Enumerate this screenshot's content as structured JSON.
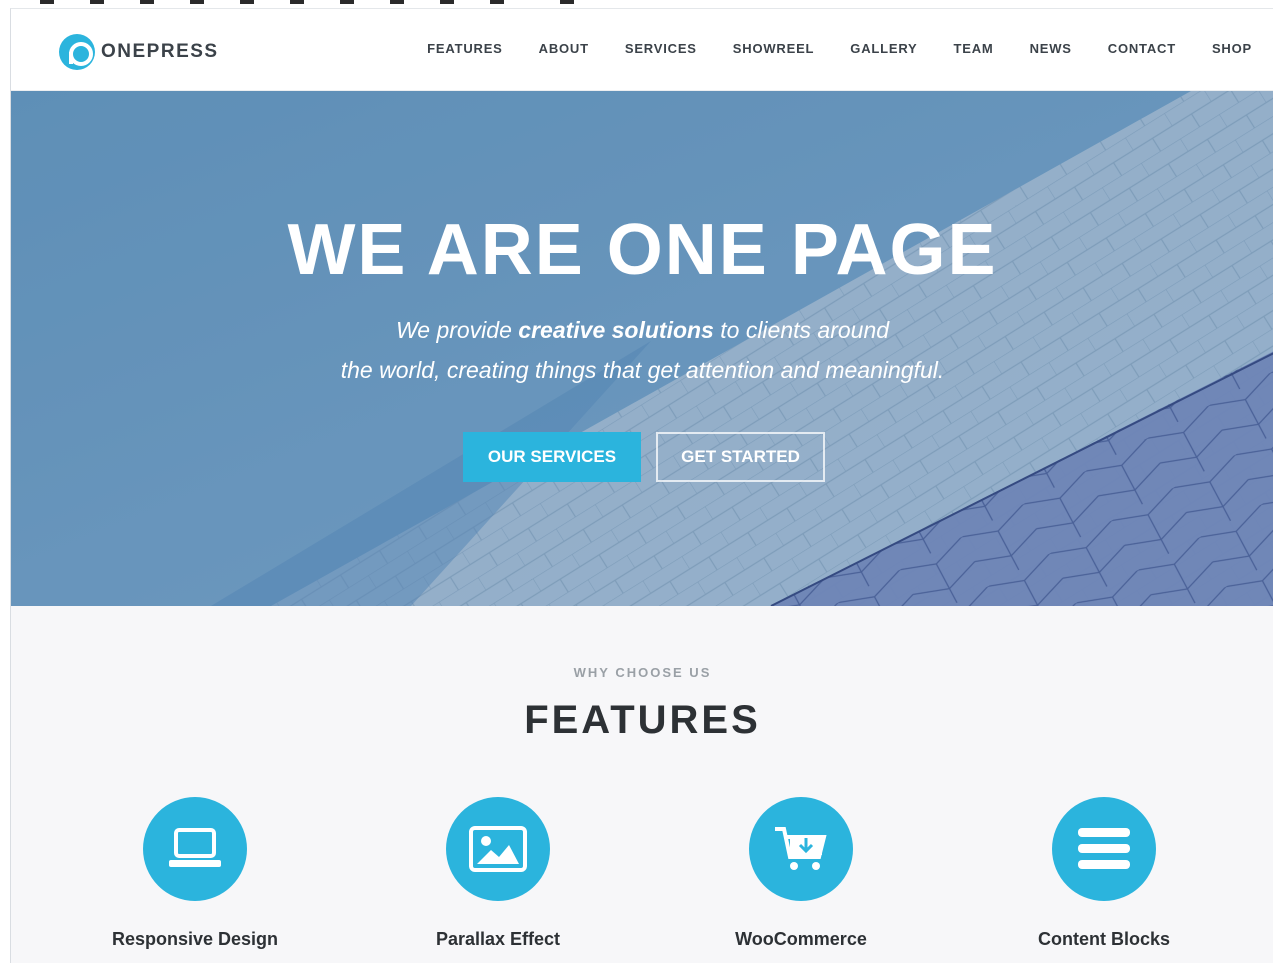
{
  "brand": {
    "name": "ONEPRESS",
    "accent_color": "#2bb4dd"
  },
  "nav": {
    "items": [
      "FEATURES",
      "ABOUT",
      "SERVICES",
      "SHOWREEL",
      "GALLERY",
      "TEAM",
      "NEWS",
      "CONTACT",
      "SHOP"
    ]
  },
  "hero": {
    "title": "WE ARE ONE PAGE",
    "line1_pre": "We provide ",
    "line1_bold": "creative solutions",
    "line1_post": " to clients around",
    "line2": "the world, creating things that get attention and meaningful.",
    "primary_button": "OUR SERVICES",
    "secondary_button": "GET STARTED"
  },
  "features": {
    "eyebrow": "WHY CHOOSE US",
    "title": "FEATURES",
    "items": [
      {
        "label": "Responsive Design",
        "icon": "laptop-icon"
      },
      {
        "label": "Parallax Effect",
        "icon": "image-icon"
      },
      {
        "label": "WooCommerce",
        "icon": "cart-download-icon"
      },
      {
        "label": "Content Blocks",
        "icon": "menu-bars-icon"
      }
    ]
  }
}
